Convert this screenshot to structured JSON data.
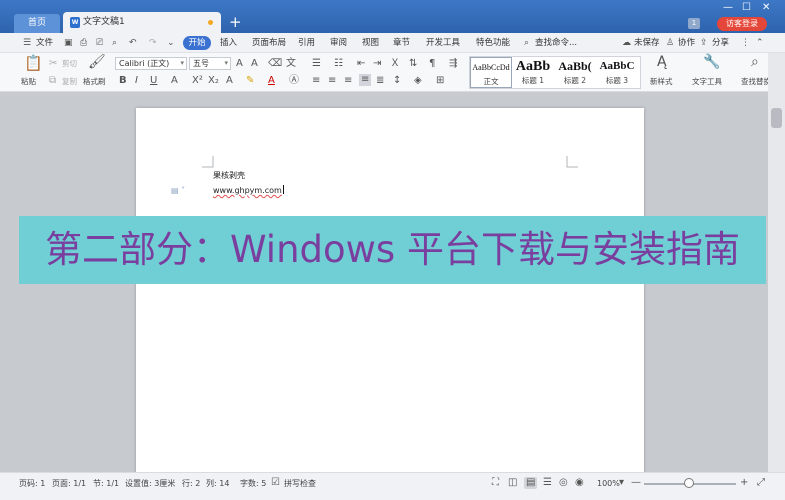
{
  "titlebar": {
    "home_tab": "首页",
    "doc_tab": "文字文稿1",
    "doc_icon": "W",
    "new_tab": "+",
    "badge": "1",
    "visitor_login": "访客登录",
    "icons": [
      "minimize-icon",
      "restore-icon",
      "close-icon"
    ]
  },
  "menubar": {
    "file": "文件",
    "start": "开始",
    "items": [
      "插入",
      "页面布局",
      "引用",
      "审阅",
      "视图",
      "章节",
      "开发工具",
      "特色功能"
    ],
    "search": "查找命令...",
    "unsaved": "未保存",
    "collab": "协作",
    "share": "分享"
  },
  "ribbon": {
    "paste": "粘贴",
    "cut": "剪切",
    "copy": "复制",
    "format_painter": "格式刷",
    "font_name": "Calibri (正文)",
    "font_size": "五号",
    "styles": [
      {
        "preview": "AaBbCcDd",
        "name": "正文"
      },
      {
        "preview": "AaBb",
        "name": "标题 1"
      },
      {
        "preview": "AaBb(",
        "name": "标题 2"
      },
      {
        "preview": "AaBbC",
        "name": "标题 3"
      }
    ],
    "new_style": "新样式",
    "text_tools": "文字工具",
    "find_replace": "查找替换"
  },
  "document": {
    "line1": "果核剥壳",
    "line2": "www.ghpym.com"
  },
  "banner": {
    "text": "第二部分：Windows 平台下载与安装指南"
  },
  "statusbar": {
    "page_num": "页码: 1",
    "page_count": "页面: 1/1",
    "section": "节: 1/1",
    "setting": "设置值: 3厘米",
    "row": "行: 2",
    "col": "列: 14",
    "words": "字数: 5",
    "spell": "拼写检查",
    "zoom": "100%",
    "zoom_level_percent": 100
  },
  "colors": {
    "titlebar": "#2e63ad",
    "accent": "#3b72d1",
    "visitor": "#e4473a",
    "banner_bg": "#6fcfd4",
    "banner_text": "#7a3f9e"
  }
}
